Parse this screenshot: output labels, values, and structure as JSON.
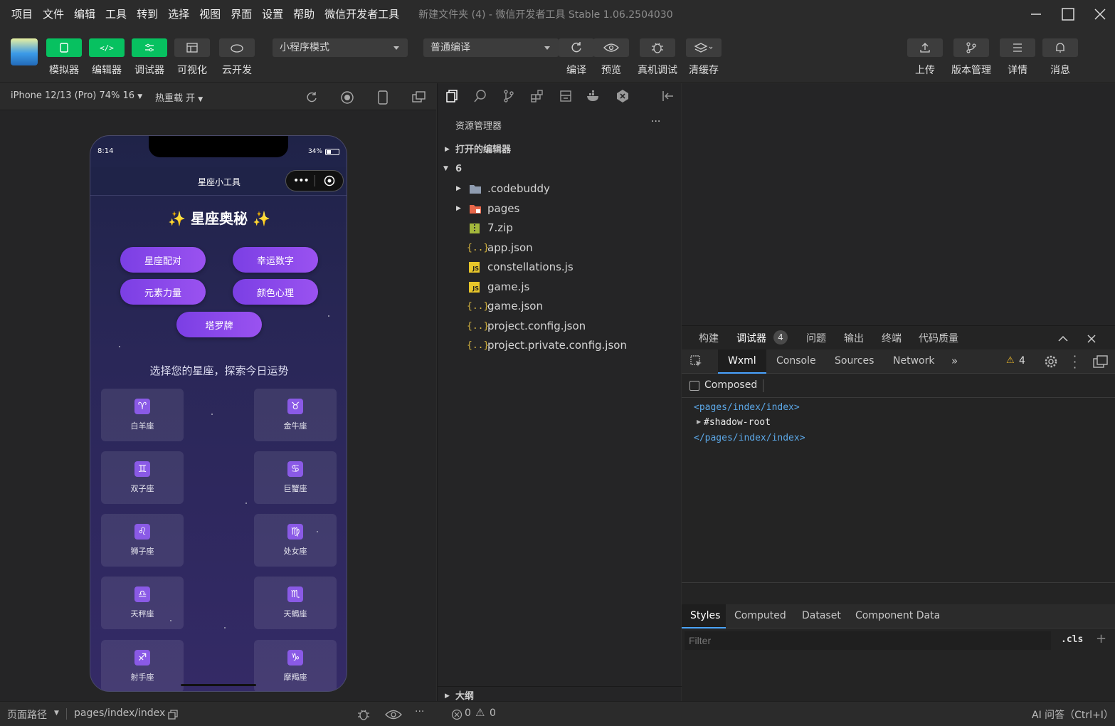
{
  "menus": [
    "项目",
    "文件",
    "编辑",
    "工具",
    "转到",
    "选择",
    "视图",
    "界面",
    "设置",
    "帮助",
    "微信开发者工具"
  ],
  "window_title": "新建文件夹 (4) - 微信开发者工具 Stable 1.06.2504030",
  "toolbar": {
    "simulator": "模拟器",
    "editor": "编辑器",
    "debugger": "调试器",
    "visual": "可视化",
    "cloud": "云开发",
    "mode_select": "小程序模式",
    "compile_select": "普通编译",
    "compile": "编译",
    "preview": "预览",
    "real_debug": "真机调试",
    "clear_cache": "清缓存",
    "upload": "上传",
    "version": "版本管理",
    "details": "详情",
    "messages": "消息"
  },
  "simbar": {
    "device": "iPhone 12/13 (Pro) 74% 16",
    "hotreload": "热重载 开"
  },
  "phone": {
    "time": "8:14",
    "battery": "34%",
    "nav_title": "星座小工具",
    "header": "✨ 星座奥秘 ✨",
    "buttons": [
      "星座配对",
      "幸运数字",
      "元素力量",
      "颜色心理",
      "塔罗牌"
    ],
    "subtitle": "选择您的星座，探索今日运势",
    "signs": [
      {
        "symbol": "♈",
        "name": "白羊座"
      },
      {
        "symbol": "♉",
        "name": "金牛座"
      },
      {
        "symbol": "♊",
        "name": "双子座"
      },
      {
        "symbol": "♋",
        "name": "巨蟹座"
      },
      {
        "symbol": "♌",
        "name": "狮子座"
      },
      {
        "symbol": "♍",
        "name": "处女座"
      },
      {
        "symbol": "♎",
        "name": "天秤座"
      },
      {
        "symbol": "♏",
        "name": "天蝎座"
      },
      {
        "symbol": "♐",
        "name": "射手座"
      },
      {
        "symbol": "♑",
        "name": "摩羯座"
      }
    ]
  },
  "explorer": {
    "title": "资源管理器",
    "more": "···",
    "open_editors": "打开的编辑器",
    "project": "6",
    "files": [
      {
        "name": ".codebuddy",
        "type": "folder"
      },
      {
        "name": "pages",
        "type": "folder-pages"
      },
      {
        "name": "7.zip",
        "type": "zip"
      },
      {
        "name": "app.json",
        "type": "json"
      },
      {
        "name": "constellations.js",
        "type": "js"
      },
      {
        "name": "game.js",
        "type": "js"
      },
      {
        "name": "game.json",
        "type": "json"
      },
      {
        "name": "project.config.json",
        "type": "json"
      },
      {
        "name": "project.private.config.json",
        "type": "json"
      }
    ],
    "outline": "大纲"
  },
  "debug": {
    "top_tabs": [
      "构建",
      "调试器",
      "问题",
      "输出",
      "终端",
      "代码质量"
    ],
    "debugger_badge": "4",
    "dev_tabs": [
      "Wxml",
      "Console",
      "Sources",
      "Network"
    ],
    "warn_count": "4",
    "composed": "Composed",
    "wxml_lines": [
      "<pages/index/index>",
      "#shadow-root",
      "</pages/index/index>"
    ],
    "style_tabs": [
      "Styles",
      "Computed",
      "Dataset",
      "Component Data"
    ],
    "filter_placeholder": "Filter",
    "cls": ".cls",
    "plus": "+"
  },
  "status": {
    "page_path_label": "页面路径",
    "page_path": "pages/index/index",
    "errors": "0",
    "warnings": "0",
    "ai": "AI 问答（Ctrl+I）"
  },
  "colors": {
    "green": "#07c160",
    "purple": "#8a4ce8",
    "accent_blue": "#4aa3ff"
  }
}
